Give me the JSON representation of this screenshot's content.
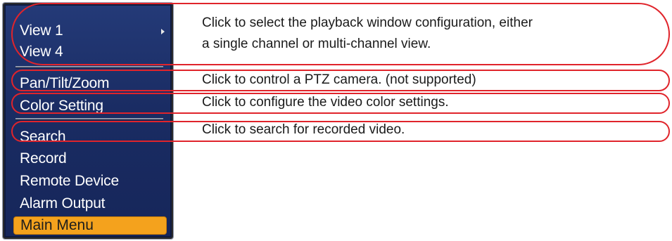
{
  "menu": {
    "items": [
      {
        "label": "View 1",
        "has_submenu": true
      },
      {
        "label": "View 4",
        "has_submenu": false
      },
      {
        "label": "Pan/Tilt/Zoom",
        "has_submenu": false
      },
      {
        "label": "Color Setting",
        "has_submenu": false
      },
      {
        "label": "Search",
        "has_submenu": false
      },
      {
        "label": "Record",
        "has_submenu": false
      },
      {
        "label": "Remote Device",
        "has_submenu": false
      },
      {
        "label": "Alarm Output",
        "has_submenu": false
      },
      {
        "label": "Main Menu",
        "has_submenu": false,
        "selected": true
      }
    ]
  },
  "descriptions": {
    "view_line1": "Click to select the playback window configuration, either",
    "view_line2": "a single channel or multi-channel view.",
    "ptz": "Click to control a PTZ camera. (not supported)",
    "color": "Click to configure the video color settings.",
    "search": "Click to search for recorded video."
  },
  "colors": {
    "menu_bg": "#1f3270",
    "menu_text": "#ffffff",
    "selected_bg": "#f4a21d",
    "callout_outline": "#e0242b"
  },
  "icons": {
    "submenu": "chevron-right-icon"
  }
}
